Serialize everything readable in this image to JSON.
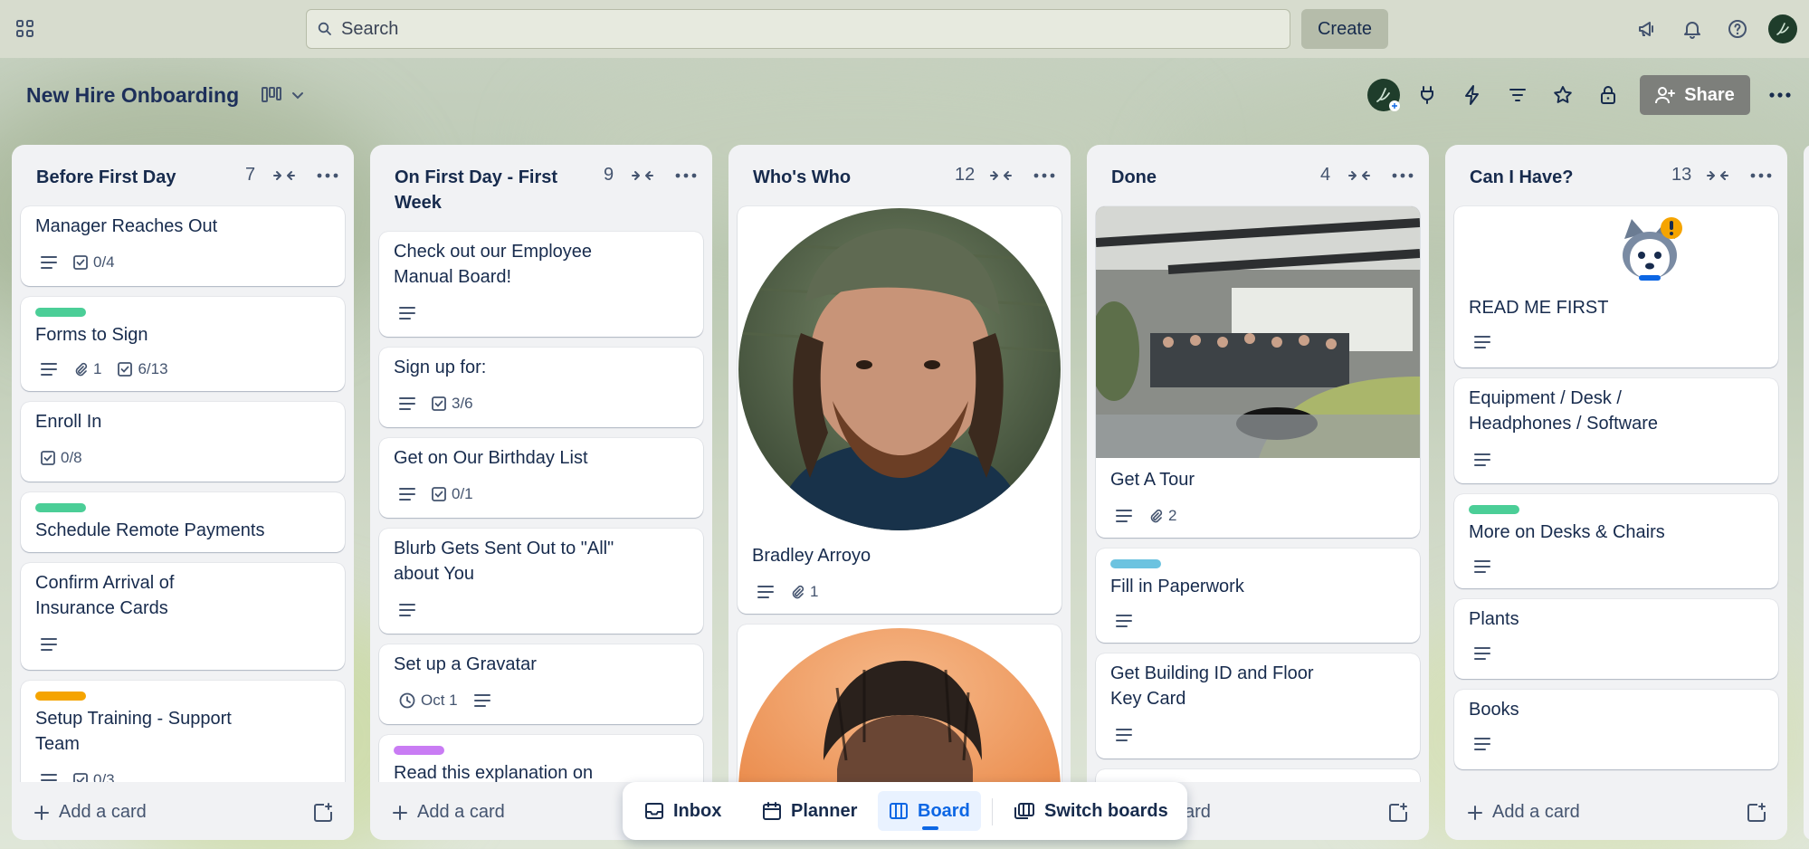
{
  "topbar": {
    "search_placeholder": "Search",
    "create_label": "Create"
  },
  "board": {
    "title": "New Hire Onboarding",
    "share_label": "Share"
  },
  "lists": [
    {
      "title": "Before First Day",
      "count": "7",
      "cards": [
        {
          "title": "Manager Reaches Out",
          "checklist": "0/4"
        },
        {
          "title": "Forms to Sign",
          "label_color": "#4bce97",
          "attachments": "1",
          "checklist": "6/13"
        },
        {
          "title": "Enroll In",
          "checklist": "0/8"
        },
        {
          "title": "Schedule Remote Payments",
          "label_color": "#4bce97"
        },
        {
          "title_line1": "Confirm Arrival of",
          "title_line2": "Insurance Cards"
        },
        {
          "title_line1": "Setup Training - Support",
          "title_line2": "Team",
          "label_color": "#f5a400",
          "checklist": "0/3"
        }
      ],
      "add_card": "Add a card"
    },
    {
      "title_line1": "On First Day - First",
      "title_line2": "Week",
      "count": "9",
      "cards": [
        {
          "title_line1": "Check out our Employee",
          "title_line2": "Manual Board!"
        },
        {
          "title": "Sign up for:",
          "checklist": "3/6"
        },
        {
          "title": "Get on Our Birthday List",
          "checklist": "0/1"
        },
        {
          "title_line1": "Blurb Gets Sent Out to \"All\"",
          "title_line2": "about You"
        },
        {
          "title": "Set up a Gravatar",
          "date": "Oct 1"
        },
        {
          "title": "Read this explanation on",
          "label_color": "#c97cf4"
        }
      ],
      "add_card": "Add a card"
    },
    {
      "title": "Who's Who",
      "count": "12",
      "cards": [
        {
          "title": "Bradley Arroyo",
          "attachments": "1"
        }
      ]
    },
    {
      "title": "Done",
      "count": "4",
      "cards": [
        {
          "title": "Get A Tour",
          "attachments": "2"
        },
        {
          "title": "Fill in Paperwork",
          "label_color": "#6cc3e0"
        },
        {
          "title_line1": "Get Building ID and Floor",
          "title_line2": "Key Card"
        }
      ],
      "add_card": "card"
    },
    {
      "title": "Can I Have?",
      "count": "13",
      "cards": [
        {
          "title": "READ ME FIRST"
        },
        {
          "title_line1": "Equipment / Desk /",
          "title_line2": "Headphones / Software"
        },
        {
          "title": "More on Desks & Chairs",
          "label_color": "#4bce97"
        },
        {
          "title": "Plants"
        },
        {
          "title": "Books"
        }
      ],
      "add_card": "Add a card"
    }
  ],
  "switcher": {
    "inbox": "Inbox",
    "planner": "Planner",
    "board": "Board",
    "switch_boards": "Switch boards"
  }
}
